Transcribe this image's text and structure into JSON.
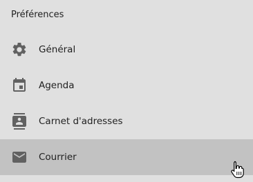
{
  "header": {
    "title": "Préférences"
  },
  "menu": {
    "items": [
      {
        "label": "Général",
        "icon": "gear-icon",
        "selected": false
      },
      {
        "label": "Agenda",
        "icon": "calendar-icon",
        "selected": false
      },
      {
        "label": "Carnet d'adresses",
        "icon": "address-book-icon",
        "selected": false
      },
      {
        "label": "Courrier",
        "icon": "mail-icon",
        "selected": true
      }
    ]
  },
  "colors": {
    "background": "#e0e0e0",
    "selected_background": "#c2c2c2",
    "icon": "#616161",
    "text": "#212121"
  }
}
